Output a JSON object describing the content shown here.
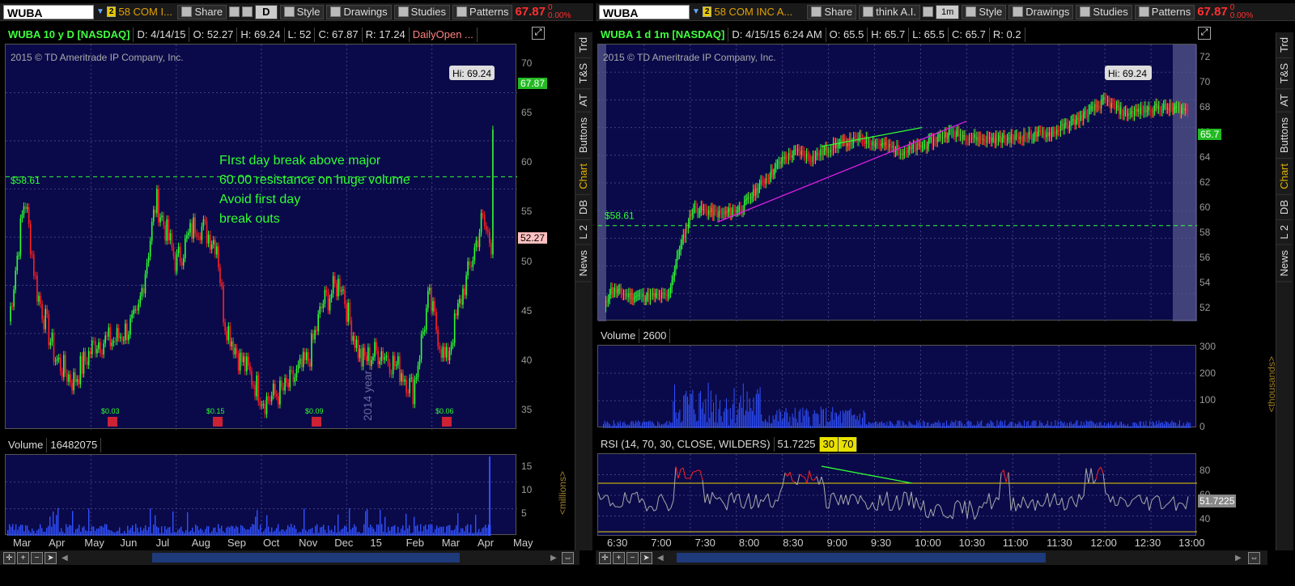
{
  "left": {
    "symbol": "WUBA",
    "desc": "58 COM I...",
    "share": "Share",
    "interval": "D",
    "style": "Style",
    "drawings": "Drawings",
    "studies": "Studies",
    "patterns": "Patterns",
    "price": "67.87",
    "pct_top": "0",
    "pct_bot": "0.00%",
    "header": {
      "title": "WUBA 10 y D [NASDAQ]",
      "d": "D: 4/14/15",
      "o": "O: 52.27",
      "h": "H: 69.24",
      "l": "L: 52",
      "c": "C: 67.87",
      "r": "R: 17.24",
      "study": "DailyOpen ..."
    },
    "copyright": "2015 © TD Ameritrade IP Company, Inc.",
    "hi_label": "Hi: 69.24",
    "price_label": "67.87",
    "open_label": "52.27",
    "line_label": "$58.61",
    "annotation": [
      "FIrst day break above major",
      "60.00 resistance on huge volume",
      "Avoid first day",
      "break outs"
    ],
    "year_label": "2014 year",
    "dividends": [
      "$0.03",
      "$0.15",
      "$0.09",
      "$0.06"
    ],
    "yticks": [
      "70",
      "65",
      "60",
      "55",
      "50",
      "45",
      "40",
      "35"
    ],
    "volume_label": "Volume",
    "volume_value": "16482075",
    "vol_ticks": [
      "15",
      "10",
      "5"
    ],
    "vol_unit": "<millions>",
    "xticks": [
      "Mar",
      "Apr",
      "May",
      "Jun",
      "Jul",
      "Aug",
      "Sep",
      "Oct",
      "Nov",
      "Dec",
      "15",
      "Feb",
      "Mar",
      "Apr",
      "May"
    ],
    "tabs": [
      "Trd",
      "T&S",
      "AT",
      "Buttons",
      "Chart",
      "DB",
      "L 2",
      "News"
    ]
  },
  "right": {
    "symbol": "WUBA",
    "desc": "58 COM INC A...",
    "share": "Share",
    "think": "think A.I.",
    "interval": "1m",
    "style": "Style",
    "drawings": "Drawings",
    "studies": "Studies",
    "patterns": "Patterns",
    "price": "67.87",
    "pct_top": "0",
    "pct_bot": "0.00%",
    "header": {
      "title": "WUBA 1 d 1m [NASDAQ]",
      "d": "D: 4/15/15 6:24 AM",
      "o": "O: 65.5",
      "h": "H: 65.7",
      "l": "L: 65.5",
      "c": "C: 65.7",
      "r": "R: 0.2"
    },
    "copyright": "2015 © TD Ameritrade IP Company, Inc.",
    "hi_label": "Hi: 69.24",
    "price_label": "65.7",
    "line_label": "$58.61",
    "yticks": [
      "72",
      "70",
      "68",
      "66",
      "64",
      "62",
      "60",
      "58",
      "56",
      "54",
      "52"
    ],
    "volume_label": "Volume",
    "volume_value": "2600",
    "vol_ticks": [
      "300",
      "200",
      "100",
      "0"
    ],
    "vol_unit": "<thousands>",
    "rsi_label": "RSI (14, 70, 30, CLOSE, WILDERS)",
    "rsi_value": "51.7225",
    "rsi_30": "30",
    "rsi_70": "70",
    "rsi_ticks": [
      "80",
      "60",
      "40"
    ],
    "rsi_badge": "51.7225",
    "xticks": [
      "6:30",
      "7:00",
      "7:30",
      "8:00",
      "8:30",
      "9:00",
      "9:30",
      "10:00",
      "10:30",
      "11:00",
      "11:30",
      "12:00",
      "12:30",
      "13:00"
    ],
    "tabs": [
      "Trd",
      "T&S",
      "AT",
      "Buttons",
      "Chart",
      "DB",
      "L 2",
      "News"
    ]
  },
  "colors": {
    "bg": "#0a0a4a",
    "up": "#30ff30",
    "down": "#ff2020",
    "accent": "#e0b000"
  }
}
